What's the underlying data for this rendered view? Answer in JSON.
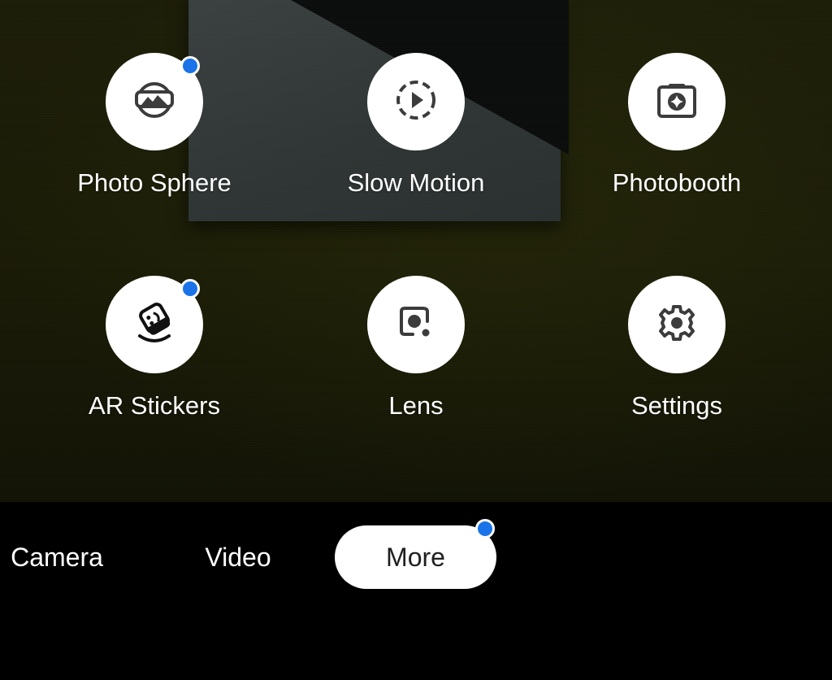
{
  "modes": [
    {
      "label": "Photo Sphere",
      "icon": "photo-sphere-icon",
      "has_badge": true
    },
    {
      "label": "Slow Motion",
      "icon": "slow-motion-icon",
      "has_badge": false
    },
    {
      "label": "Photobooth",
      "icon": "photobooth-icon",
      "has_badge": false
    },
    {
      "label": "AR Stickers",
      "icon": "ar-stickers-icon",
      "has_badge": true
    },
    {
      "label": "Lens",
      "icon": "lens-icon",
      "has_badge": false
    },
    {
      "label": "Settings",
      "icon": "settings-icon",
      "has_badge": false
    }
  ],
  "tabs": [
    {
      "label": "Camera",
      "active": false
    },
    {
      "label": "Video",
      "active": false
    },
    {
      "label": "More",
      "active": true,
      "has_badge": true
    }
  ],
  "colors": {
    "badge": "#1a73e8",
    "icon": "#3c3c3c",
    "active_tab_bg": "#ffffff",
    "active_tab_text": "#1f1f1f"
  }
}
